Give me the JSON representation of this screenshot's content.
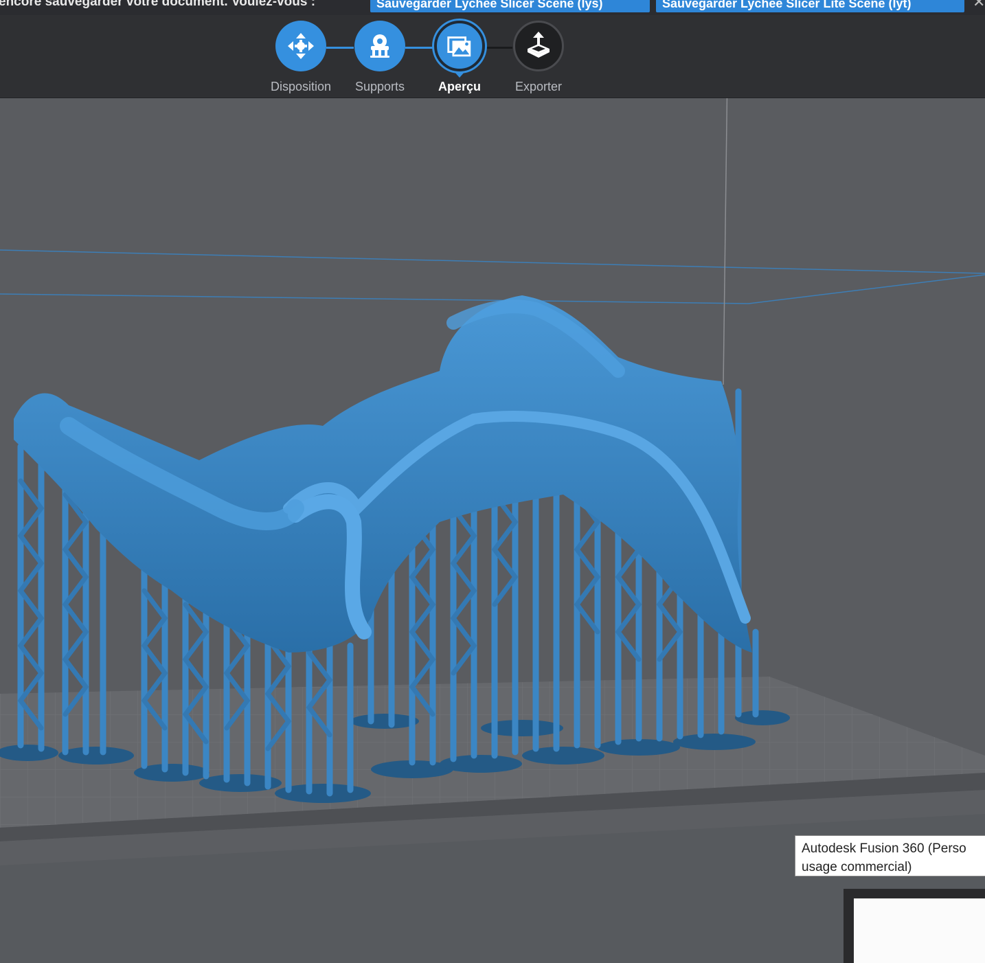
{
  "notification": {
    "message": "encore sauvegarder votre document. Voulez-vous :",
    "save_lys_label": "Sauvegarder Lychee Slicer Scene (lys)",
    "save_lyt_label": "Sauvegarder Lychee Slicer Lite Scene (lyt)",
    "close_glyph": "✕"
  },
  "workflow": {
    "steps": [
      {
        "label": "Disposition",
        "icon": "move-arrows-icon",
        "state": "done"
      },
      {
        "label": "Supports",
        "icon": "supports-icon",
        "state": "done"
      },
      {
        "label": "Aperçu",
        "icon": "preview-image-icon",
        "state": "active"
      },
      {
        "label": "Exporter",
        "icon": "export-upload-icon",
        "state": "todo"
      }
    ]
  },
  "taskbar_tooltip": {
    "line1": "Autodesk Fusion 360 (Perso",
    "line2": "usage commercial)"
  },
  "colors": {
    "accent": "#3590df",
    "model": "#3b86c4",
    "viewport_bg": "#5a5c60",
    "toolbar_bg": "#2f3033"
  }
}
